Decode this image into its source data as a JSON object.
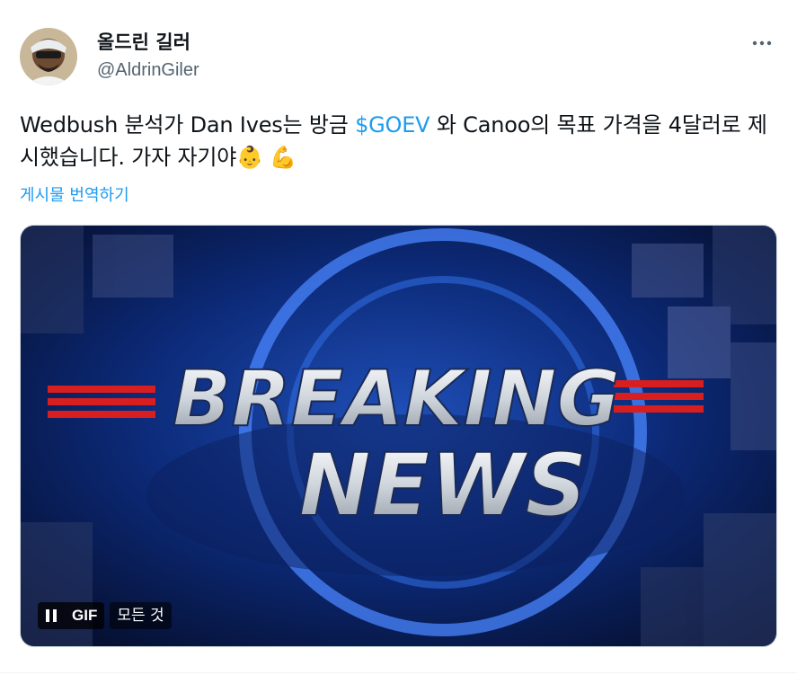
{
  "author": {
    "display_name": "올드린 길러",
    "handle": "@AldrinGiler"
  },
  "tweet": {
    "text_before": "Wedbush 분석가 Dan Ives는 방금 ",
    "cashtag": "$GOEV",
    "text_after": " 와 Canoo의 목표 가격을 4달러로 제시했습니다. 가자 자기야👶 💪",
    "translate_label": "게시물 번역하기"
  },
  "media": {
    "headline_line1": "BREAKING",
    "headline_line2": "NEWS",
    "gif_label": "GIF",
    "alt_label": "모든 것"
  },
  "icons": {
    "more": "more-options-icon",
    "pause": "pause-icon"
  },
  "colors": {
    "accent": "#1d9bf0",
    "secondary_text": "#536471"
  }
}
